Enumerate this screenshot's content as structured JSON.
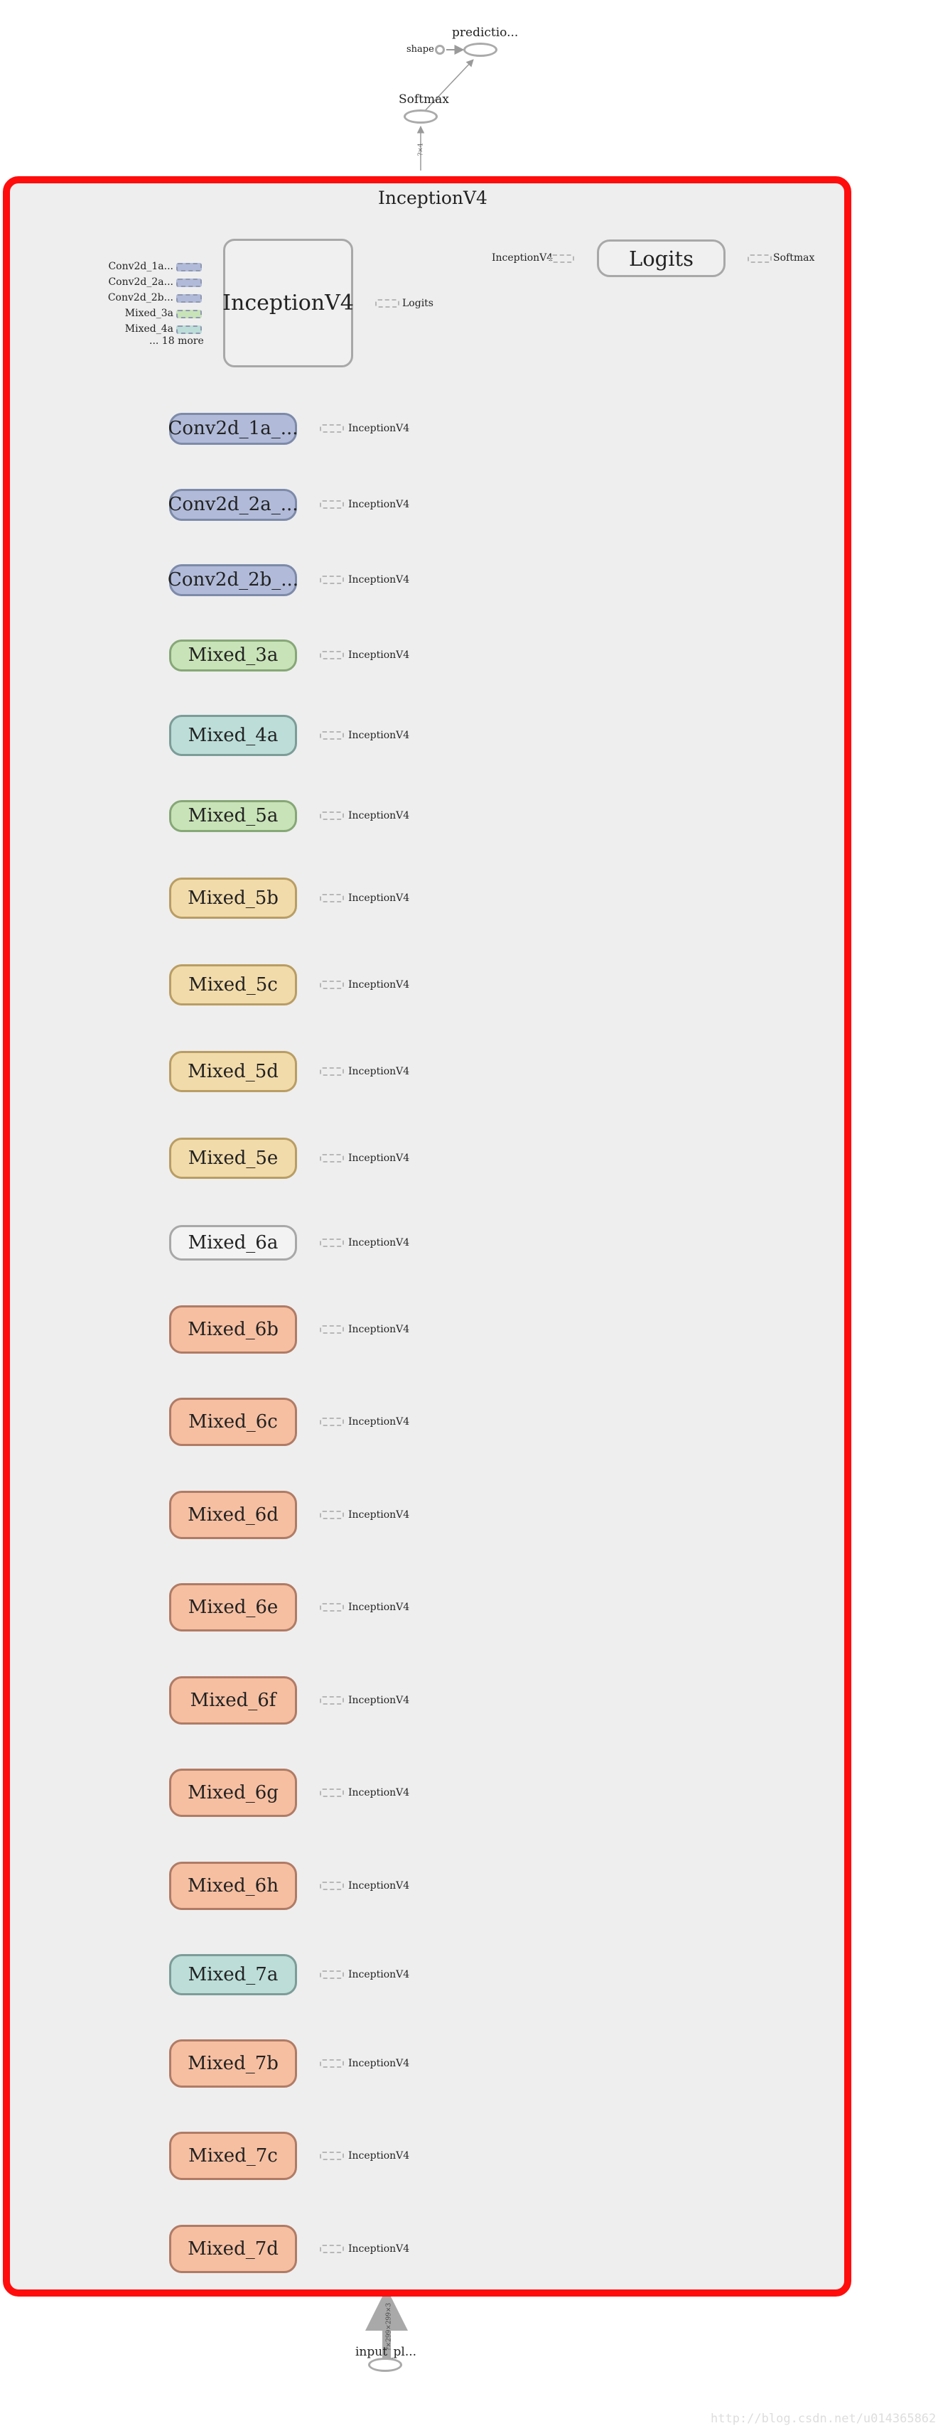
{
  "top": {
    "prediction_label": "predictio...",
    "shape_label": "shape",
    "softmax_label": "Softmax",
    "edge_label": "?×4"
  },
  "group": {
    "title": "InceptionV4",
    "border_color": "#ff0d0d"
  },
  "summary": {
    "main_node_label": "InceptionV4",
    "output_label": "Logits",
    "inputs": [
      {
        "label": "Conv2d_1a...",
        "color": "#b1bbd9"
      },
      {
        "label": "Conv2d_2a...",
        "color": "#b1bbd9"
      },
      {
        "label": "Conv2d_2b...",
        "color": "#b1bbd9"
      },
      {
        "label": "Mixed_3a",
        "color": "#c8e3b7"
      },
      {
        "label": "Mixed_4a",
        "color": "#bcddd8"
      }
    ],
    "more_label": "... 18 more",
    "logits_input_label": "InceptionV4",
    "logits_node_label": "Logits",
    "logits_output_label": "Softmax"
  },
  "nodes": [
    {
      "label": "Conv2d_1a_...",
      "output": "InceptionV4",
      "fill": "#b1bbd9",
      "border": "#7d8aa9"
    },
    {
      "label": "Conv2d_2a_...",
      "output": "InceptionV4",
      "fill": "#b1bbd9",
      "border": "#7d8aa9"
    },
    {
      "label": "Conv2d_2b_...",
      "output": "InceptionV4",
      "fill": "#b1bbd9",
      "border": "#7d8aa9"
    },
    {
      "label": "Mixed_3a",
      "output": "InceptionV4",
      "fill": "#c8e3b7",
      "border": "#86a776"
    },
    {
      "label": "Mixed_4a",
      "output": "InceptionV4",
      "fill": "#bcddd8",
      "border": "#7c9c98"
    },
    {
      "label": "Mixed_5a",
      "output": "InceptionV4",
      "fill": "#c8e3b7",
      "border": "#86a776"
    },
    {
      "label": "Mixed_5b",
      "output": "InceptionV4",
      "fill": "#f2dbaa",
      "border": "#b99d63"
    },
    {
      "label": "Mixed_5c",
      "output": "InceptionV4",
      "fill": "#f2dbaa",
      "border": "#b99d63"
    },
    {
      "label": "Mixed_5d",
      "output": "InceptionV4",
      "fill": "#f2dbaa",
      "border": "#b99d63"
    },
    {
      "label": "Mixed_5e",
      "output": "InceptionV4",
      "fill": "#f2dbaa",
      "border": "#b99d63"
    },
    {
      "label": "Mixed_6a",
      "output": "InceptionV4",
      "fill": "#f3f3f3",
      "border": "#a8a8a8"
    },
    {
      "label": "Mixed_6b",
      "output": "InceptionV4",
      "fill": "#f6bfa1",
      "border": "#b07b65"
    },
    {
      "label": "Mixed_6c",
      "output": "InceptionV4",
      "fill": "#f6bfa1",
      "border": "#b07b65"
    },
    {
      "label": "Mixed_6d",
      "output": "InceptionV4",
      "fill": "#f6bfa1",
      "border": "#b07b65"
    },
    {
      "label": "Mixed_6e",
      "output": "InceptionV4",
      "fill": "#f6bfa1",
      "border": "#b07b65"
    },
    {
      "label": "Mixed_6f",
      "output": "InceptionV4",
      "fill": "#f6bfa1",
      "border": "#b07b65"
    },
    {
      "label": "Mixed_6g",
      "output": "InceptionV4",
      "fill": "#f6bfa1",
      "border": "#b07b65"
    },
    {
      "label": "Mixed_6h",
      "output": "InceptionV4",
      "fill": "#f6bfa1",
      "border": "#b07b65"
    },
    {
      "label": "Mixed_7a",
      "output": "InceptionV4",
      "fill": "#bcddd8",
      "border": "#7c9c98"
    },
    {
      "label": "Mixed_7b",
      "output": "InceptionV4",
      "fill": "#f6bfa1",
      "border": "#b07b65"
    },
    {
      "label": "Mixed_7c",
      "output": "InceptionV4",
      "fill": "#f6bfa1",
      "border": "#b07b65"
    },
    {
      "label": "Mixed_7d",
      "output": "InceptionV4",
      "fill": "#f6bfa1",
      "border": "#b07b65"
    }
  ],
  "bottom": {
    "input_label": "input_pl...",
    "edge_label": "?×299×299×3"
  },
  "watermark": "http://blog.csdn.net/u014365862"
}
